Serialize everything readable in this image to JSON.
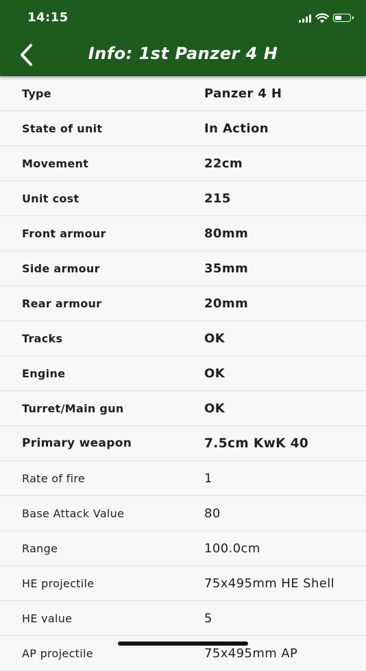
{
  "status_bar": {
    "time": "14:15",
    "icons": [
      "cellular-signal-icon",
      "wifi-icon",
      "battery-icon"
    ]
  },
  "header": {
    "title": "Info: 1st Panzer 4 H",
    "back_icon": "chevron-left-icon",
    "background_color": "#1e5c1e"
  },
  "rows": [
    {
      "label": "Type",
      "value": "Panzer 4 H"
    },
    {
      "label": "State of unit",
      "value": "In Action"
    },
    {
      "label": "Movement",
      "value": "22cm"
    },
    {
      "label": "Unit cost",
      "value": "215"
    },
    {
      "label": "Front armour",
      "value": "80mm"
    },
    {
      "label": "Side armour",
      "value": "35mm"
    },
    {
      "label": "Rear armour",
      "value": "20mm"
    },
    {
      "label": "Tracks",
      "value": "OK"
    },
    {
      "label": "Engine",
      "value": "OK"
    },
    {
      "label": "Turret/Main gun",
      "value": "OK"
    },
    {
      "label": "Primary weapon",
      "value": "7.5cm KwK 40"
    },
    {
      "label": "Rate of fire",
      "value": "1"
    },
    {
      "label": "Base Attack Value",
      "value": "80"
    },
    {
      "label": "Range",
      "value": "100.0cm"
    },
    {
      "label": "HE projectile",
      "value": "75x495mm HE Shell"
    },
    {
      "label": "HE value",
      "value": "5"
    },
    {
      "label": "AP projectile",
      "value": "75x495mm AP"
    }
  ]
}
